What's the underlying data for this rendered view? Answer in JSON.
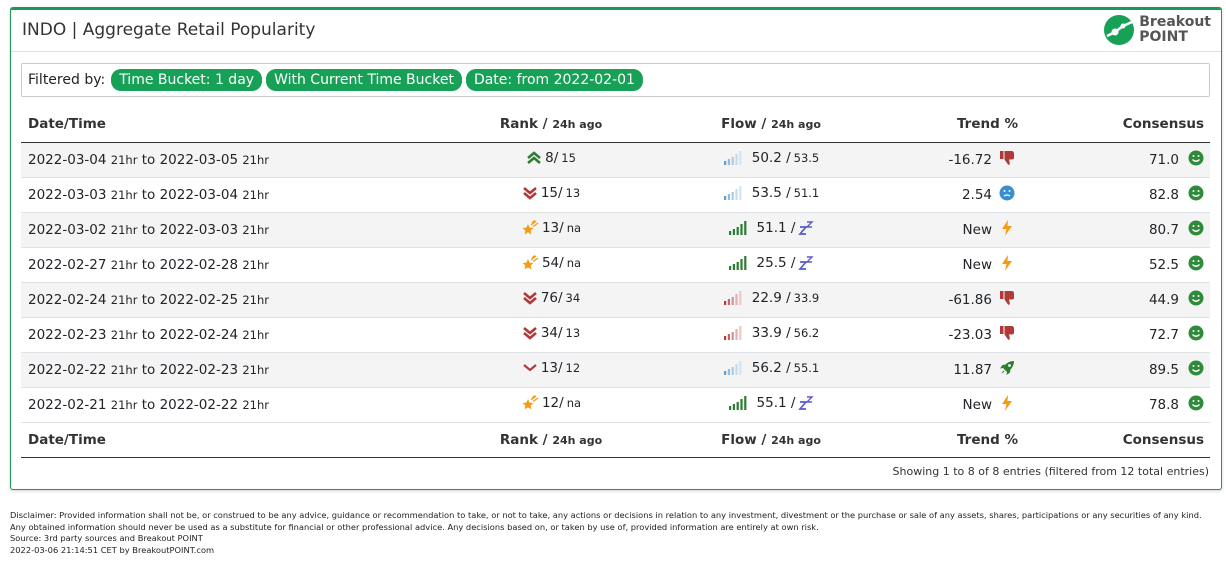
{
  "header": {
    "title": "INDO | Aggregate Retail Popularity",
    "logo_line1": "Breakout",
    "logo_line2": "POINT"
  },
  "filters": {
    "label": "Filtered by:",
    "pills": [
      "Time Bucket:  1 day",
      "With Current Time Bucket",
      "Date:  from 2022-02-01"
    ]
  },
  "table": {
    "headers": {
      "date": "Date/Time",
      "rank": "Rank",
      "rank_sub": "24h ago",
      "flow": "Flow",
      "flow_sub": "24h ago",
      "trend": "Trend %",
      "consensus": "Consensus"
    },
    "rows": [
      {
        "from": "2022-03-04",
        "from_hr": "21hr",
        "to_word": "to",
        "to": "2022-03-05",
        "to_hr": "21hr",
        "rank_icon": "double-chevron-up-icon",
        "rank": "8/",
        "rank_prev": "15",
        "flow_icon": "signal-bars-blue-icon",
        "flow": "50.2 /",
        "flow_prev": "53.5",
        "trend": "-16.72",
        "trend_icon": "thumbs-down-icon",
        "consensus": "71.0",
        "consensus_icon": "smile-icon"
      },
      {
        "from": "2022-03-03",
        "from_hr": "21hr",
        "to_word": "to",
        "to": "2022-03-04",
        "to_hr": "21hr",
        "rank_icon": "double-chevron-down-icon",
        "rank": "15/",
        "rank_prev": "13",
        "flow_icon": "signal-bars-blue-icon",
        "flow": "53.5 /",
        "flow_prev": "51.1",
        "trend": "2.54",
        "trend_icon": "neutral-face-icon",
        "consensus": "82.8",
        "consensus_icon": "smile-icon"
      },
      {
        "from": "2022-03-02",
        "from_hr": "21hr",
        "to_word": "to",
        "to": "2022-03-03",
        "to_hr": "21hr",
        "rank_icon": "shooting-star-icon",
        "rank": "13/",
        "rank_prev": "na",
        "flow_icon": "signal-bars-green-icon",
        "flow": "51.1 /",
        "flow_prev": "",
        "trend": "New",
        "trend_icon": "lightning-icon",
        "consensus": "80.7",
        "consensus_icon": "smile-icon"
      },
      {
        "from": "2022-02-27",
        "from_hr": "21hr",
        "to_word": "to",
        "to": "2022-02-28",
        "to_hr": "21hr",
        "rank_icon": "shooting-star-icon",
        "rank": "54/",
        "rank_prev": "na",
        "flow_icon": "signal-bars-green-icon",
        "flow": "25.5 /",
        "flow_prev": "",
        "trend": "New",
        "trend_icon": "lightning-icon",
        "consensus": "52.5",
        "consensus_icon": "smile-icon"
      },
      {
        "from": "2022-02-24",
        "from_hr": "21hr",
        "to_word": "to",
        "to": "2022-02-25",
        "to_hr": "21hr",
        "rank_icon": "double-chevron-down-icon",
        "rank": "76/",
        "rank_prev": "34",
        "flow_icon": "signal-bars-red-icon",
        "flow": "22.9 /",
        "flow_prev": "33.9",
        "trend": "-61.86",
        "trend_icon": "thumbs-down-icon",
        "consensus": "44.9",
        "consensus_icon": "smile-icon"
      },
      {
        "from": "2022-02-23",
        "from_hr": "21hr",
        "to_word": "to",
        "to": "2022-02-24",
        "to_hr": "21hr",
        "rank_icon": "double-chevron-down-icon",
        "rank": "34/",
        "rank_prev": "13",
        "flow_icon": "signal-bars-red-icon",
        "flow": "33.9 /",
        "flow_prev": "56.2",
        "trend": "-23.03",
        "trend_icon": "thumbs-down-icon",
        "consensus": "72.7",
        "consensus_icon": "smile-icon"
      },
      {
        "from": "2022-02-22",
        "from_hr": "21hr",
        "to_word": "to",
        "to": "2022-02-23",
        "to_hr": "21hr",
        "rank_icon": "chevron-down-icon",
        "rank": "13/",
        "rank_prev": "12",
        "flow_icon": "signal-bars-blue-icon",
        "flow": "56.2 /",
        "flow_prev": "55.1",
        "trend": "11.87",
        "trend_icon": "rocket-icon",
        "consensus": "89.5",
        "consensus_icon": "smile-icon"
      },
      {
        "from": "2022-02-21",
        "from_hr": "21hr",
        "to_word": "to",
        "to": "2022-02-22",
        "to_hr": "21hr",
        "rank_icon": "shooting-star-icon",
        "rank": "12/",
        "rank_prev": "na",
        "flow_icon": "signal-bars-green-icon",
        "flow": "55.1 /",
        "flow_prev": "",
        "trend": "New",
        "trend_icon": "lightning-icon",
        "consensus": "78.8",
        "consensus_icon": "smile-icon"
      }
    ],
    "info": "Showing 1 to 8 of 8 entries (filtered from 12 total entries)"
  },
  "footer": {
    "disclaimer": "Disclaimer: Provided information shall not be, or construed to be any advice, guidance or recommendation to take, or not to take, any actions or decisions in relation to any investment, divestment or the purchase or sale of any assets, shares, participations or any securities of any kind. Any obtained information should never be used as a substitute for financial or other professional advice. Any decisions based on, or taken by use of, provided information are entirely at own risk.",
    "source": "Source: 3rd party sources and Breakout POINT",
    "timestamp": "2022-03-06 21:14:51 CET by BreakoutPOINT.com"
  },
  "colors": {
    "brand_green": "#17a156",
    "down_red": "#b03a3a",
    "up_green": "#2e7d32",
    "star_orange": "#f39c12",
    "blue": "#3a8fd0"
  }
}
